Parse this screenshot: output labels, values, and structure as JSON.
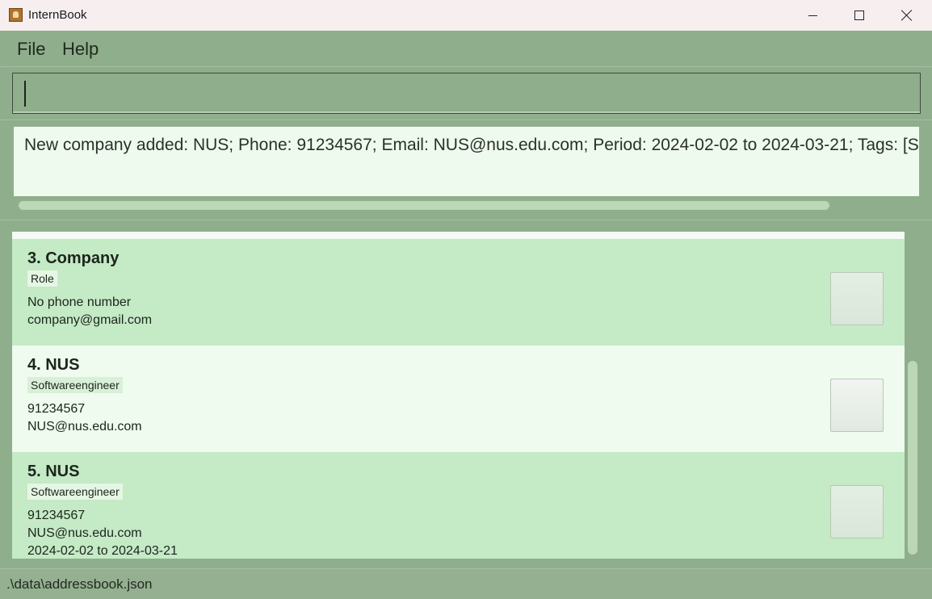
{
  "window": {
    "title": "InternBook"
  },
  "menu": {
    "file": "File",
    "help": "Help"
  },
  "command_box": {
    "value": ""
  },
  "result": {
    "text": "New company added: NUS; Phone: 91234567; Email: NUS@nus.edu.com; Period: 2024-02-02 to 2024-03-21; Tags: [Softwareengineer]"
  },
  "list": {
    "cards": [
      {
        "title": "3.  Company",
        "tag": "Role",
        "lines": [
          "No phone number",
          "company@gmail.com"
        ]
      },
      {
        "title": "4.  NUS",
        "tag": "Softwareengineer",
        "lines": [
          "91234567",
          "NUS@nus.edu.com"
        ]
      },
      {
        "title": "5.  NUS",
        "tag": "Softwareengineer",
        "lines": [
          "91234567",
          "NUS@nus.edu.com",
          "2024-02-02 to 2024-03-21"
        ]
      }
    ]
  },
  "status_bar": {
    "path": ".\\data\\addressbook.json"
  },
  "colors": {
    "background": "#8fae8b",
    "card_dark": "#c5eac6",
    "card_light": "#eefbee",
    "result_bg": "#effaef"
  }
}
